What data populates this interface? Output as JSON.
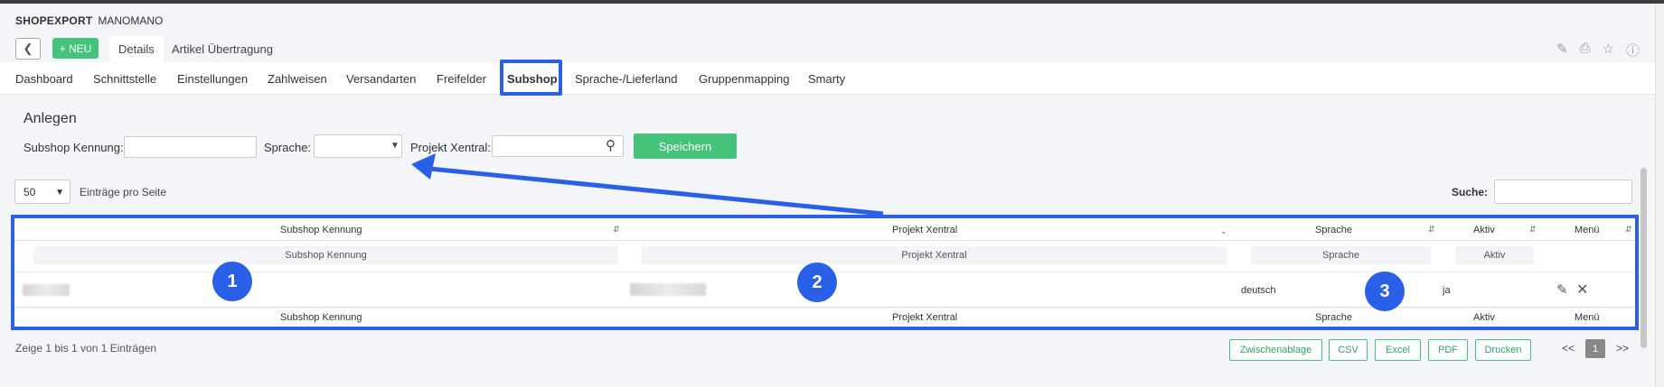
{
  "app": {
    "module": "SHOPEXPORT",
    "name": "MANOMANO"
  },
  "header": {
    "new_label": "+ NEU",
    "subtabs": [
      "Details",
      "Artikel Übertragung"
    ]
  },
  "nav": {
    "items": [
      "Dashboard",
      "Schnittstelle",
      "Einstellungen",
      "Zahlweisen",
      "Versandarten",
      "Freifelder",
      "Subshop",
      "Sprache-/Lieferland",
      "Gruppenmapping",
      "Smarty"
    ],
    "active": "Subshop"
  },
  "create_form": {
    "title": "Anlegen",
    "subshop_label": "Subshop Kennung:",
    "subshop_value": "",
    "sprache_label": "Sprache:",
    "sprache_value": "",
    "projekt_label": "Projekt Xentral:",
    "projekt_value": "",
    "save_label": "Speichern"
  },
  "list_controls": {
    "page_size": "50",
    "page_size_label": "Einträge pro Seite",
    "search_label": "Suche:",
    "search_value": ""
  },
  "table": {
    "columns": [
      "Subshop Kennung",
      "Projekt Xentral",
      "Sprache",
      "Aktiv",
      "Menü"
    ],
    "filter_placeholders": [
      "Subshop Kennung",
      "Projekt Xentral",
      "Sprache",
      "Aktiv"
    ],
    "rows": [
      {
        "subshop": "",
        "projekt": "",
        "sprache": "deutsch",
        "aktiv": "ja"
      }
    ]
  },
  "annotations": [
    "1",
    "2",
    "3"
  ],
  "footer": {
    "info": "Zeige 1 bis 1 von 1 Einträgen",
    "export_buttons": [
      "Zwischenablage",
      "CSV",
      "Excel",
      "PDF",
      "Drucken"
    ],
    "pager": {
      "prev": "<<",
      "current": "1",
      "next": ">>"
    }
  },
  "colors": {
    "accent_green": "#45c37a",
    "highlight_blue": "#2a5fe8"
  }
}
